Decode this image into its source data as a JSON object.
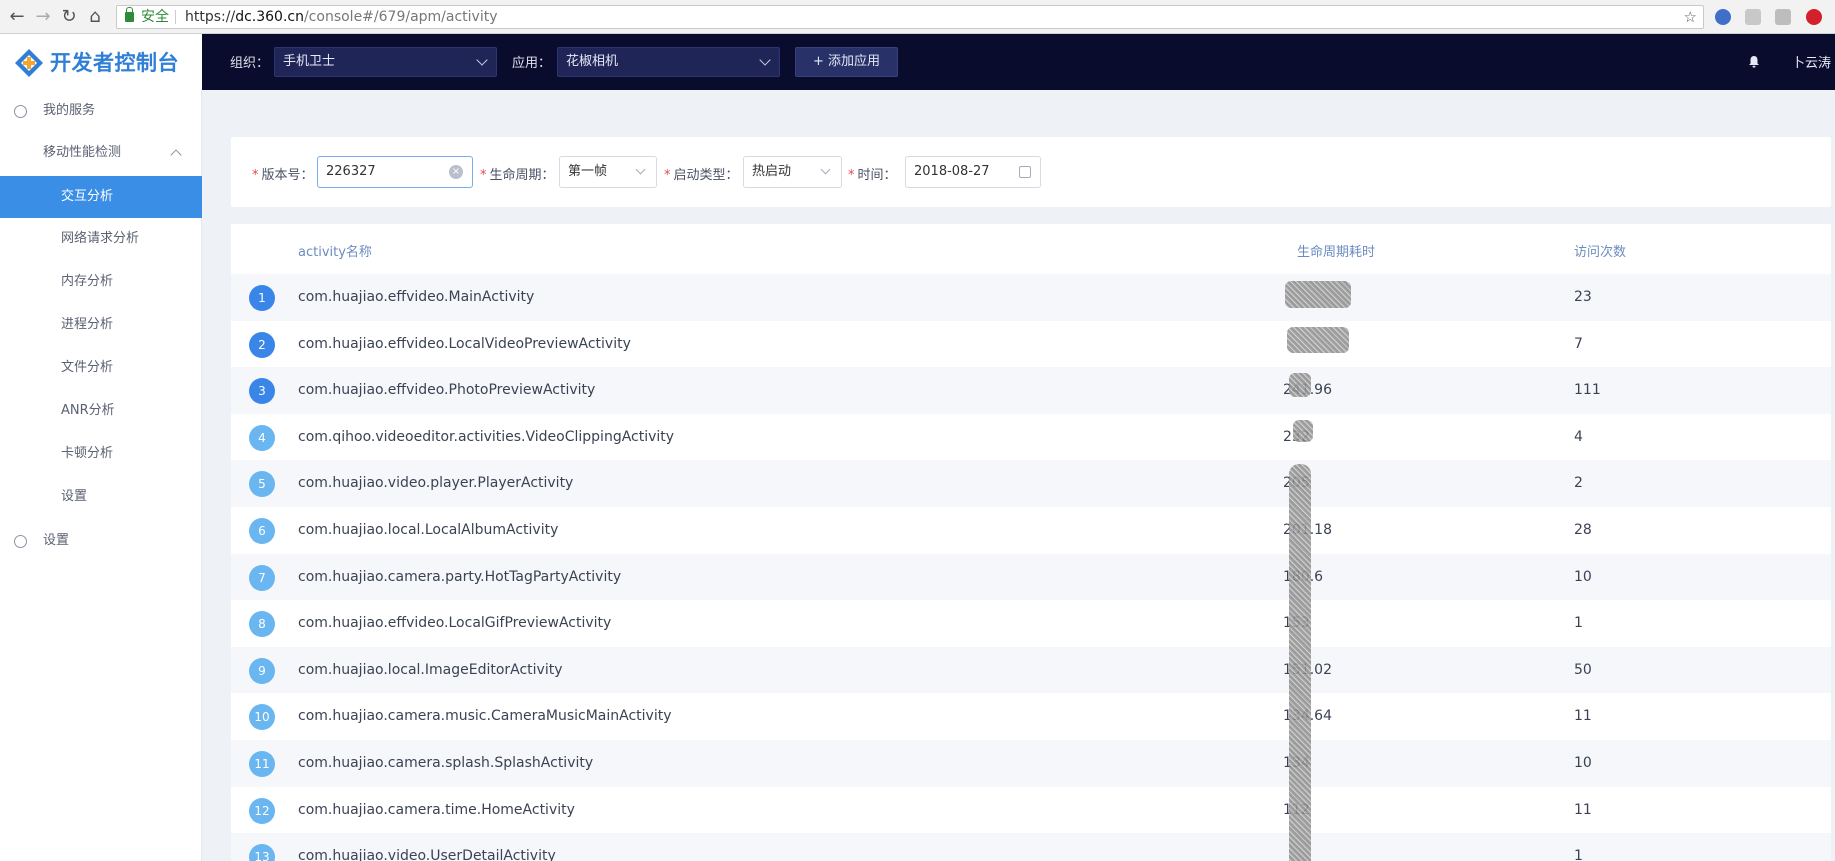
{
  "browser": {
    "secure_label": "安全",
    "url_scheme": "https://",
    "url_host": "dc.360.cn",
    "url_path": "/console#/679/apm/activity"
  },
  "header": {
    "logo_text": "开发者控制台",
    "org_label": "组织：",
    "org_value": "手机卫士",
    "app_label": "应用：",
    "app_value": "花椒相机",
    "add_app_label": "+ 添加应用",
    "user_name": "卜云涛"
  },
  "sidebar": {
    "my_services": "我的服务",
    "group_label": "移动性能检测",
    "items": [
      {
        "label": "交互分析",
        "active": true
      },
      {
        "label": "网络请求分析"
      },
      {
        "label": "内存分析"
      },
      {
        "label": "进程分析"
      },
      {
        "label": "文件分析"
      },
      {
        "label": "ANR分析"
      },
      {
        "label": "卡顿分析"
      },
      {
        "label": "设置"
      }
    ],
    "settings": "设置"
  },
  "filters": {
    "version_label": "版本号：",
    "version_value": "226327",
    "lifecycle_label": "生命周期：",
    "lifecycle_value": "第一帧",
    "launch_label": "启动类型：",
    "launch_value": "热启动",
    "time_label": "时间：",
    "time_value": "2018-08-27",
    "required_mark": "*"
  },
  "table": {
    "columns": [
      "activity名称",
      "生命周期耗时",
      "访问次数"
    ],
    "rows": [
      {
        "rank": "1",
        "name": "com.huajiao.effvideo.MainActivity",
        "duration": "",
        "count": "23"
      },
      {
        "rank": "2",
        "name": "com.huajiao.effvideo.LocalVideoPreviewActivity",
        "duration": "",
        "count": "7"
      },
      {
        "rank": "3",
        "name": "com.huajiao.effvideo.PhotoPreviewActivity",
        "duration": "241.96",
        "count": "111"
      },
      {
        "rank": "4",
        "name": "com.qihoo.videoeditor.activities.VideoClippingActivity",
        "duration": "232",
        "count": "4"
      },
      {
        "rank": "5",
        "name": "com.huajiao.video.player.PlayerActivity",
        "duration": "205",
        "count": "2"
      },
      {
        "rank": "6",
        "name": "com.huajiao.local.LocalAlbumActivity",
        "duration": "201.18",
        "count": "28"
      },
      {
        "rank": "7",
        "name": "com.huajiao.camera.party.HotTagPartyActivity",
        "duration": "180.6",
        "count": "10"
      },
      {
        "rank": "8",
        "name": "com.huajiao.effvideo.LocalGifPreviewActivity",
        "duration": "153",
        "count": "1"
      },
      {
        "rank": "9",
        "name": "com.huajiao.local.ImageEditorActivity",
        "duration": "151.02",
        "count": "50"
      },
      {
        "rank": "10",
        "name": "com.huajiao.camera.music.CameraMusicMainActivity",
        "duration": "134.64",
        "count": "11"
      },
      {
        "rank": "11",
        "name": "com.huajiao.camera.splash.SplashActivity",
        "duration": "134",
        "count": "10"
      },
      {
        "rank": "12",
        "name": "com.huajiao.camera.time.HomeActivity",
        "duration": "112",
        "count": "11"
      },
      {
        "rank": "13",
        "name": "com.huajiao.video.UserDetailActivity",
        "duration": "",
        "count": "1"
      }
    ]
  },
  "colors": {
    "header_bg": "#0a0c2e",
    "accent": "#3a8ee6",
    "rank_top": "#3a86e8",
    "rank_rest": "#6ab6f0"
  }
}
